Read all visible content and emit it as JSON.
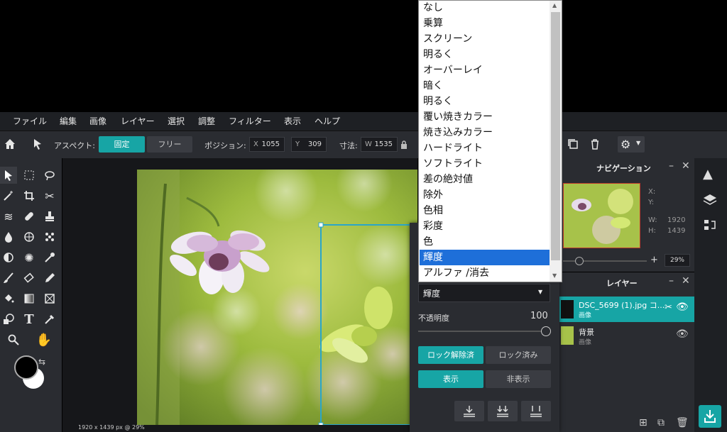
{
  "menu": [
    "ファイル",
    "編集",
    "画像",
    "レイヤー",
    "選択",
    "調整",
    "フィルター",
    "表示",
    "ヘルプ"
  ],
  "toolbar": {
    "aspect_label": "アスペクト:",
    "fixed_label": "固定",
    "free_label": "フリー",
    "position_label": "ポジション:",
    "x_label": "X",
    "x_value": "1055",
    "y_label": "Y",
    "y_value": "309",
    "size_label": "寸法:",
    "w_label": "W",
    "w_value": "1535"
  },
  "blend_modes": [
    "なし",
    "乗算",
    "スクリーン",
    "明るく",
    "オーバーレイ",
    "暗く",
    "明るく",
    "覆い焼きカラー",
    "焼き込みカラー",
    "ハードライト",
    "ソフトライト",
    "差の絶対値",
    "除外",
    "色相",
    "彩度",
    "色",
    "輝度",
    "アルファ /消去"
  ],
  "selected_blend_mode": "輝度",
  "props": {
    "blend_value": "輝度",
    "opacity_label": "不透明度",
    "opacity_value": "100",
    "unlocked_label": "ロック解除済",
    "locked_label": "ロック済み",
    "show_label": "表示",
    "hide_label": "非表示"
  },
  "navigator": {
    "title": "ナビゲーション",
    "x_label": "X:",
    "y_label": "Y:",
    "w_label": "W:",
    "w_value": "1920",
    "h_label": "H:",
    "h_value": "1439",
    "zoom": "29%"
  },
  "layers": {
    "title": "レイヤー",
    "items": [
      {
        "name": "DSC_5699 (1).jpg コ...",
        "type": "画像",
        "active": true
      },
      {
        "name": "背景",
        "type": "画像",
        "active": false
      }
    ]
  },
  "status": "1920 x 1439 px @ 29%",
  "colors": {
    "accent": "#17a5a5",
    "highlight": "#1e6fd9",
    "panel": "#2a2c31"
  }
}
